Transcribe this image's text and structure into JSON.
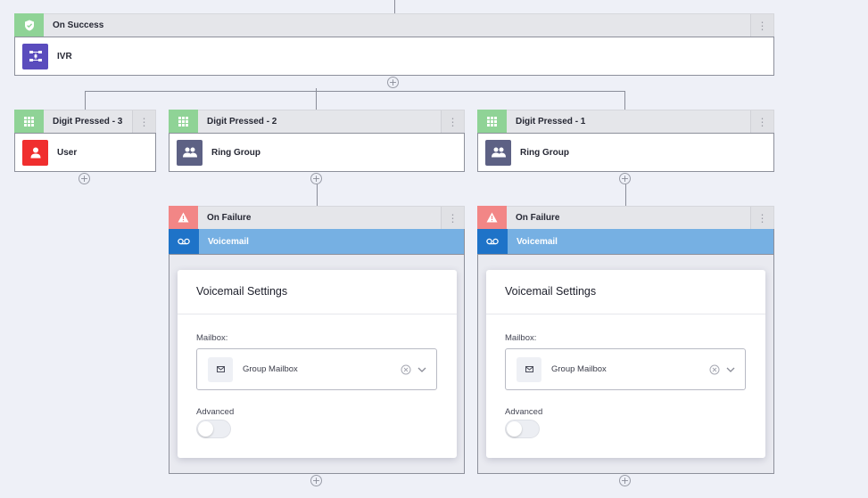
{
  "flow": {
    "on_success": {
      "header_label": "On Success",
      "header_icon": "shield-check-icon",
      "body_label": "IVR",
      "body_icon": "ivr-icon"
    },
    "branches": [
      {
        "header_label": "Digit Pressed - 3",
        "header_icon": "keypad-icon",
        "body_label": "User",
        "body_icon": "user-icon"
      },
      {
        "header_label": "Digit Pressed - 2",
        "header_icon": "keypad-icon",
        "body_label": "Ring Group",
        "body_icon": "group-icon"
      },
      {
        "header_label": "Digit Pressed - 1",
        "header_icon": "keypad-icon",
        "body_label": "Ring Group",
        "body_icon": "group-icon"
      }
    ],
    "failures": [
      {
        "header_label": "On Failure",
        "header_icon": "warning-icon",
        "action_label": "Voicemail",
        "action_icon": "voicemail-icon",
        "panel": {
          "title": "Voicemail Settings",
          "mailbox_label": "Mailbox:",
          "mailbox_value": "Group Mailbox",
          "advanced_label": "Advanced",
          "advanced_enabled": false
        }
      },
      {
        "header_label": "On Failure",
        "header_icon": "warning-icon",
        "action_label": "Voicemail",
        "action_icon": "voicemail-icon",
        "panel": {
          "title": "Voicemail Settings",
          "mailbox_label": "Mailbox:",
          "mailbox_value": "Group Mailbox",
          "advanced_label": "Advanced",
          "advanced_enabled": false
        }
      }
    ],
    "add_symbol": "+",
    "menu_symbol": "⋮"
  },
  "colors": {
    "success": "#8fd396",
    "failure": "#f28686",
    "ivr": "#5a4cbd",
    "user": "#f02e2e",
    "ring_group": "#5d6184",
    "voicemail_bar": "#76b0e3",
    "voicemail_icon": "#1e73c8"
  }
}
